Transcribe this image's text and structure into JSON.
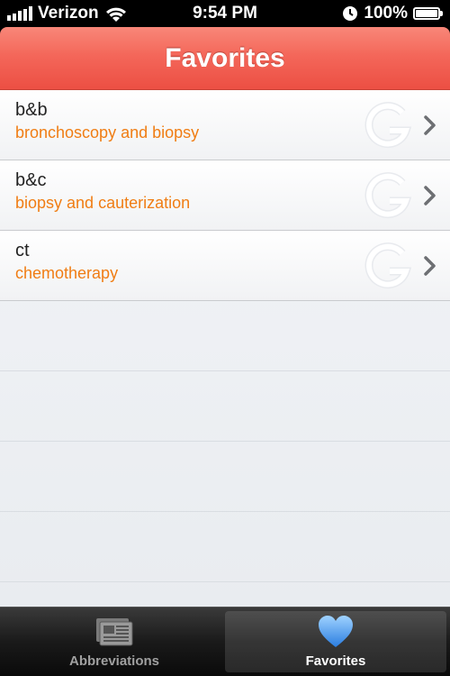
{
  "status_bar": {
    "carrier": "Verizon",
    "time": "9:54 PM",
    "battery": "100%",
    "battery_level": 1.0,
    "signal_bars": 5
  },
  "nav": {
    "title": "Favorites"
  },
  "favorites": [
    {
      "abbr": "b&b",
      "definition": "bronchoscopy and biopsy",
      "icon": "google-search-icon"
    },
    {
      "abbr": "b&c",
      "definition": "biopsy and cauterization",
      "icon": "google-search-icon"
    },
    {
      "abbr": "ct",
      "definition": "chemotherapy",
      "icon": "google-search-icon"
    }
  ],
  "tabs": [
    {
      "label": "Abbreviations",
      "icon": "abbreviations-icon",
      "active": false
    },
    {
      "label": "Favorites",
      "icon": "heart-icon",
      "active": true
    }
  ],
  "colors": {
    "nav_gradient_top": "#f88779",
    "nav_gradient_bottom": "#ec4f43",
    "definition_text": "#f07d14",
    "heart_blue": "#3e8ee8"
  }
}
